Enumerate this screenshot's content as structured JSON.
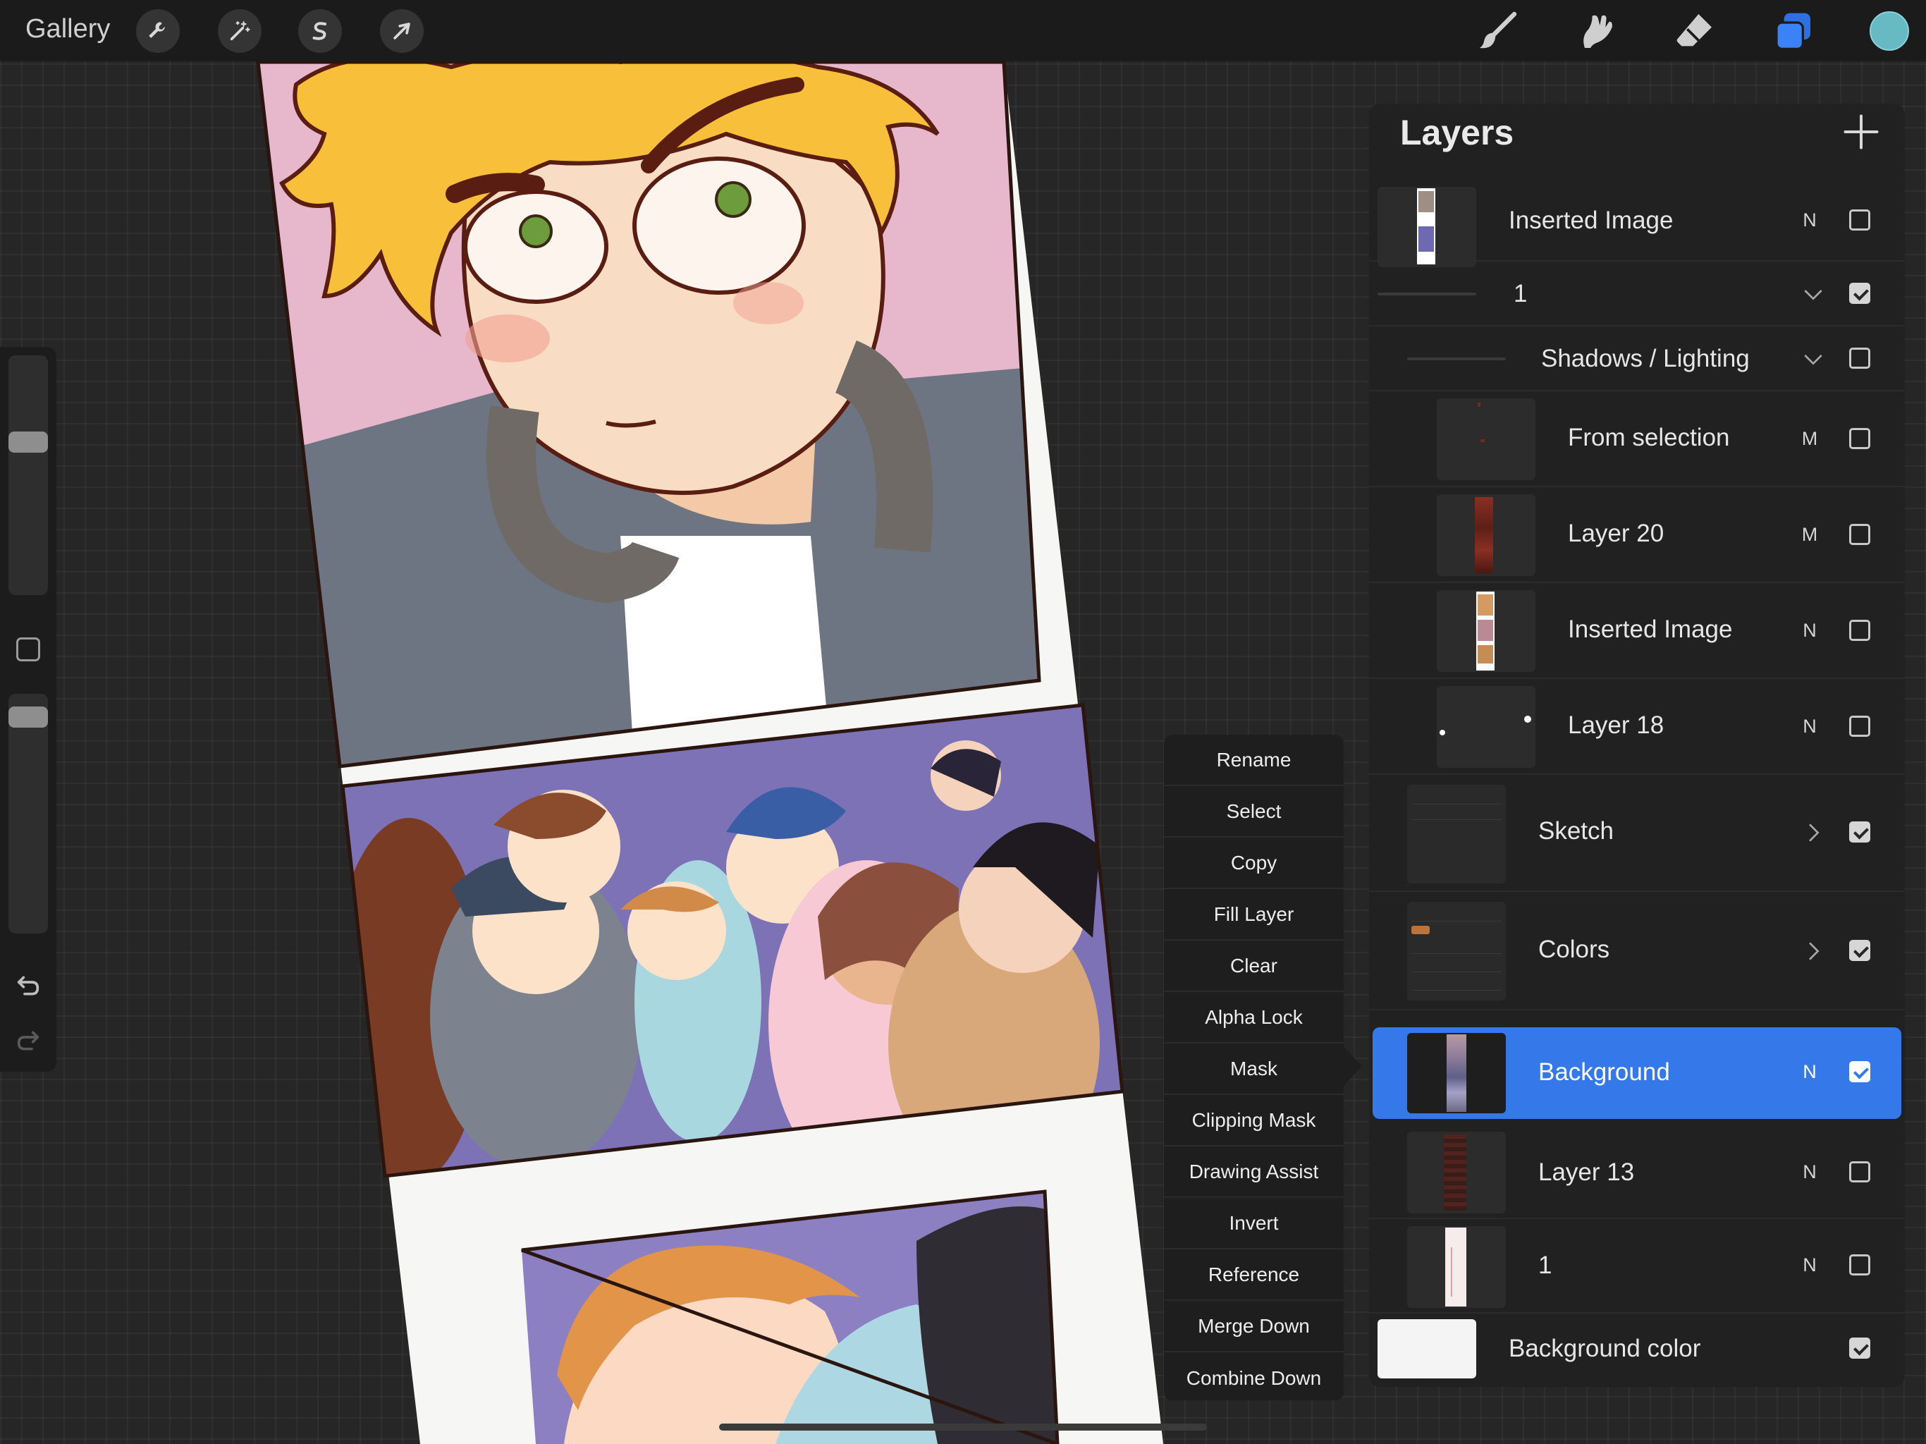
{
  "topbar": {
    "gallery_label": "Gallery",
    "left_tools": [
      "wrench-icon",
      "magic-wand-icon",
      "selection-s-icon",
      "transform-arrow-icon"
    ],
    "right_tools": [
      "brush-icon",
      "smudge-icon",
      "eraser-icon",
      "layers-icon"
    ],
    "active_tool": "layers-icon",
    "current_color": "#67b9c3"
  },
  "sidebar": {
    "brush_size_level": 0.68,
    "opacity_level": 0.96,
    "undo_icon": "undo-icon",
    "redo_icon": "redo-icon"
  },
  "menu": {
    "items": [
      "Rename",
      "Select",
      "Copy",
      "Fill Layer",
      "Clear",
      "Alpha Lock",
      "Mask",
      "Clipping Mask",
      "Drawing Assist",
      "Invert",
      "Reference",
      "Merge Down",
      "Combine Down"
    ]
  },
  "layers": {
    "title": "Layers",
    "accent": "#3478e9",
    "rows": [
      {
        "name": "Inserted Image",
        "blend": "N",
        "visible": false
      },
      {
        "name": "1",
        "blend": "",
        "visible": true,
        "group": "expanded"
      },
      {
        "name": "Shadows / Lighting",
        "blend": "",
        "visible": false,
        "group": "expanded"
      },
      {
        "name": "From selection",
        "blend": "M",
        "visible": false
      },
      {
        "name": "Layer 20",
        "blend": "M",
        "visible": false
      },
      {
        "name": "Inserted Image",
        "blend": "N",
        "visible": false
      },
      {
        "name": "Layer 18",
        "blend": "N",
        "visible": false
      },
      {
        "name": "Sketch",
        "blend": "",
        "visible": true,
        "group": "collapsed"
      },
      {
        "name": "Colors",
        "blend": "",
        "visible": true,
        "group": "collapsed"
      },
      {
        "name": "Background",
        "blend": "N",
        "visible": true,
        "selected": true
      },
      {
        "name": "Layer 13",
        "blend": "N",
        "visible": false
      },
      {
        "name": "1",
        "blend": "N",
        "visible": false
      },
      {
        "name": "Background color",
        "blend": "",
        "visible": true
      }
    ]
  }
}
